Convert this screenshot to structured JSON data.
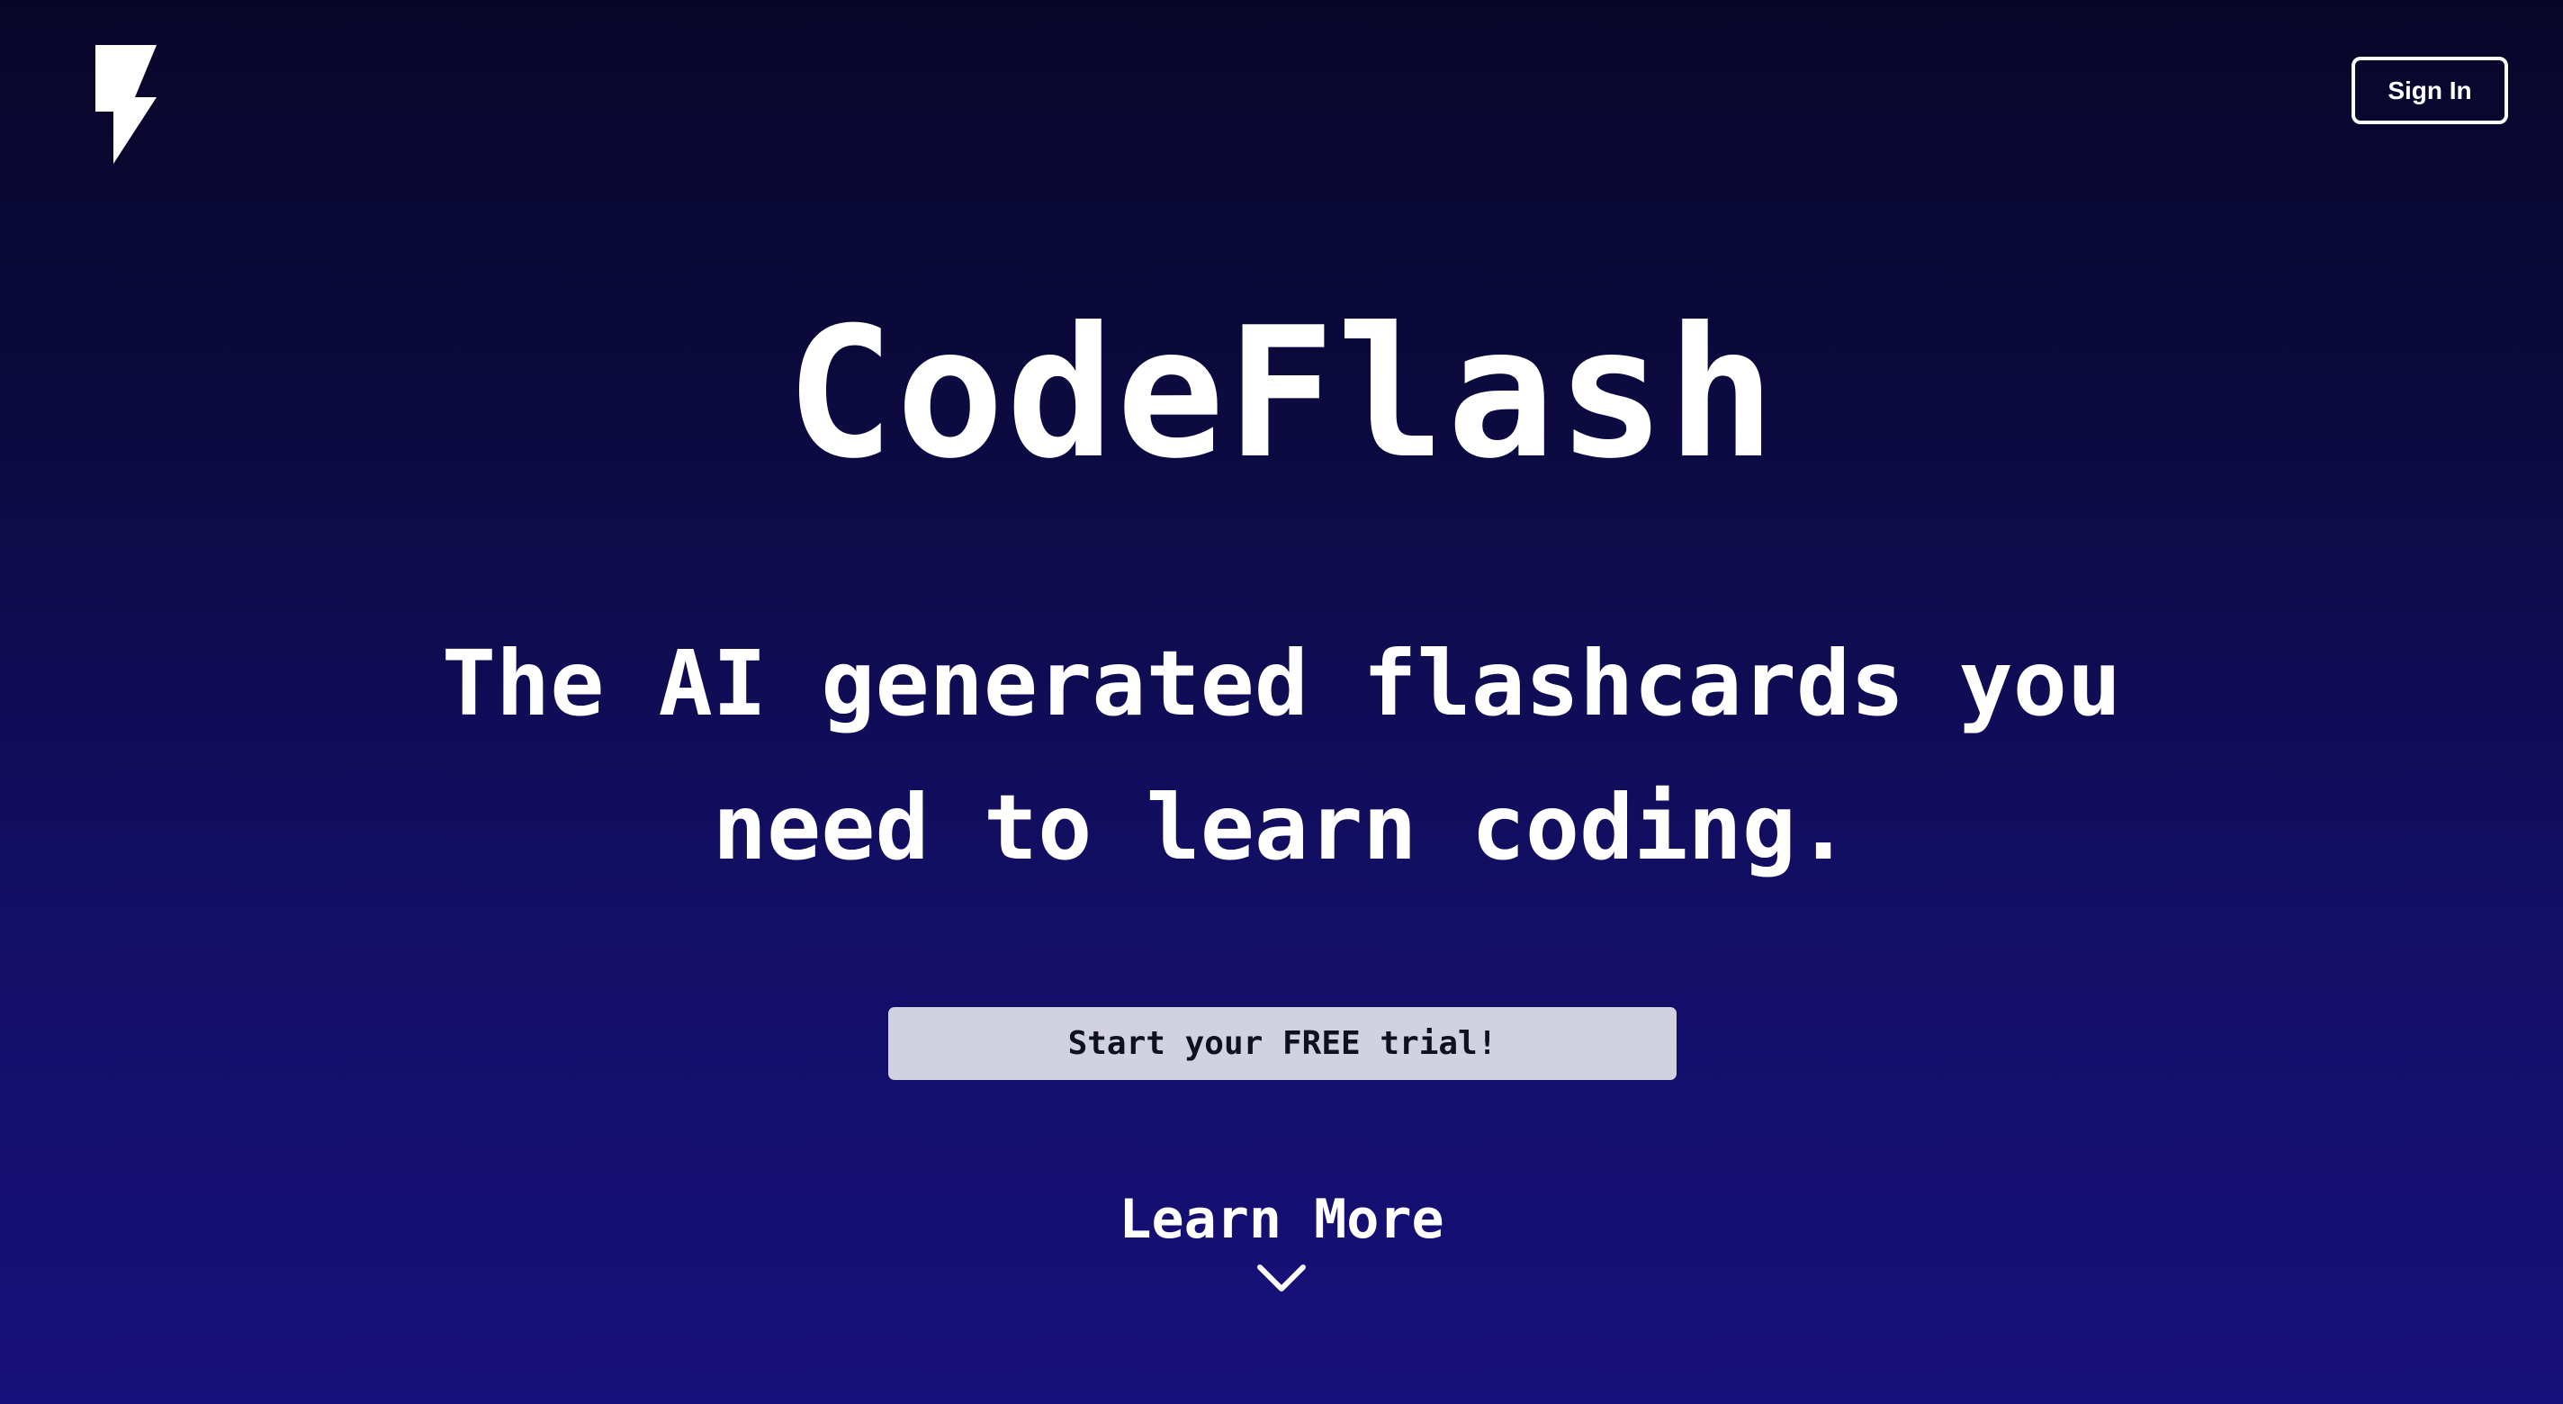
{
  "header": {
    "logo_icon": "lightning-bolt-icon",
    "sign_in_label": "Sign In"
  },
  "hero": {
    "brand": "CodeFlash",
    "tagline_line1": "The AI generated flashcards you",
    "tagline_line2": "need to learn coding.",
    "cta_label": "Start your FREE trial!",
    "learn_more_label": "Learn More",
    "learn_more_icon": "chevron-down-icon"
  },
  "colors": {
    "background_top": "#080628",
    "background_bottom": "#18107a",
    "cta_background": "#d2d1e0",
    "text": "#ffffff"
  }
}
